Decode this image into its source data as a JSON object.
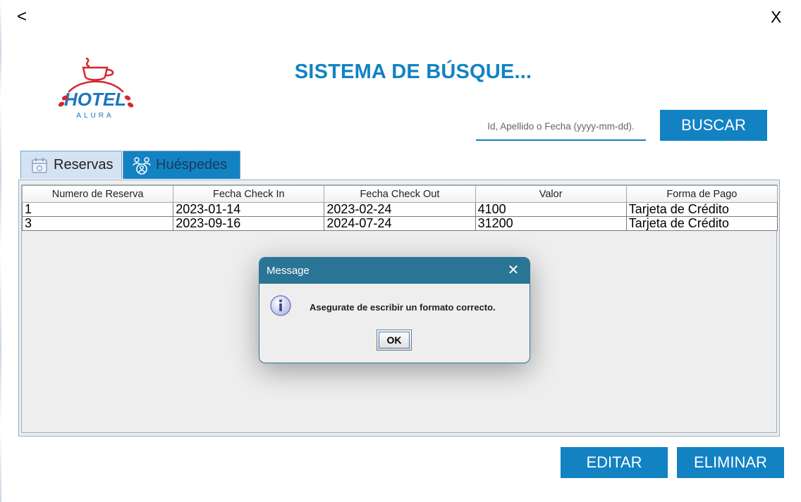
{
  "nav": {
    "back_label": "<",
    "close_label": "X"
  },
  "header": {
    "title": "SISTEMA DE BÚSQUE...",
    "logo": {
      "word": "HOTEL",
      "sub": "ALURA",
      "icon": "coffee-cup-icon"
    }
  },
  "search": {
    "placeholder": "Id, Apellido o Fecha (yyyy-mm-dd).",
    "value": "",
    "button_label": "BUSCAR"
  },
  "tabs": [
    {
      "label": "Reservas",
      "icon": "calendar-icon",
      "selected": true
    },
    {
      "label": "Huéspedes",
      "icon": "guests-icon",
      "selected": false
    }
  ],
  "table": {
    "columns": [
      "Numero de Reserva",
      "Fecha Check In",
      "Fecha Check Out",
      "Valor",
      "Forma de Pago"
    ],
    "rows": [
      [
        "1",
        "2023-01-14",
        "2023-02-24",
        "4100",
        "Tarjeta de Crédito"
      ],
      [
        "3",
        "2023-09-16",
        "2024-07-24",
        "31200",
        "Tarjeta de Crédito"
      ]
    ]
  },
  "actions": {
    "edit_label": "EDITAR",
    "delete_label": "ELIMINAR"
  },
  "dialog": {
    "title": "Message",
    "close_label": "✕",
    "icon": "info-icon",
    "message": "Asegurate de escribir un formato correcto.",
    "ok_label": "OK"
  },
  "colors": {
    "accent": "#1282c3",
    "dialog_bar": "#2a7595",
    "logo_red": "#d7262e",
    "logo_blue": "#1c75bc"
  }
}
